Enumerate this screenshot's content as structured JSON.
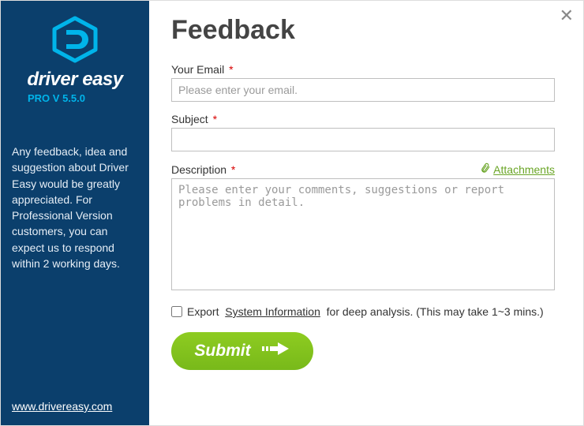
{
  "brand": {
    "name": "driver easy",
    "version": "PRO V 5.5.0"
  },
  "sidebar": {
    "body": "Any feedback, idea and suggestion about Driver Easy would be greatly appreciated. For Professional Version customers, you can expect us to respond within 2 working days.",
    "link": "www.drivereasy.com"
  },
  "form": {
    "title": "Feedback",
    "email_label": "Your Email",
    "email_placeholder": "Please enter your email.",
    "subject_label": "Subject",
    "description_label": "Description",
    "description_placeholder": "Please enter your comments, suggestions or report problems in detail.",
    "attachments_label": "Attachments",
    "export_prefix": "Export",
    "export_link": "System Information",
    "export_suffix": "for deep analysis. (This may take 1~3 mins.)",
    "submit_label": "Submit"
  },
  "colors": {
    "sidebar_bg": "#0b3f6c",
    "accent_cyan": "#00b4ea",
    "accent_green": "#7fc41e",
    "required_red": "#d80000"
  }
}
